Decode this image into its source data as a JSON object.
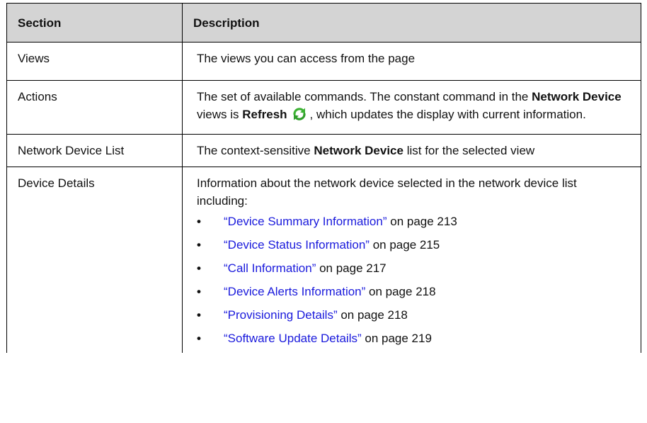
{
  "headers": {
    "section": "Section",
    "description": "Description"
  },
  "rows": {
    "views": {
      "section": "Views",
      "description": "The views you can access from the page"
    },
    "actions": {
      "section": "Actions",
      "text_1": "The set of available commands. The constant command in the ",
      "bold_1": "Network Device",
      "text_2": " views is ",
      "bold_2": "Refresh",
      "text_3": ", which updates the display with current information.",
      "icon": "refresh-icon"
    },
    "list": {
      "section": "Network Device List",
      "text_1": "The context-sensitive ",
      "bold_1": "Network Device",
      "text_2": " list for the selected view"
    },
    "details": {
      "section": "Device Details",
      "intro": "Information about the network device selected in the network device list including:",
      "bullet": "•",
      "items": [
        {
          "link": "“Device Summary Information”",
          "suffix": " on page 213"
        },
        {
          "link": "“Device Status Information”",
          "suffix": " on page 215"
        },
        {
          "link": "“Call Information”",
          "suffix": " on page 217"
        },
        {
          "link": "“Device Alerts Information”",
          "suffix": " on page 218"
        },
        {
          "link": "“Provisioning Details”",
          "suffix": " on page 218"
        },
        {
          "link": "“Software Update Details”",
          "suffix": " on page 219"
        }
      ]
    }
  },
  "colors": {
    "header_bg": "#d4d4d4",
    "link": "#1a1adc",
    "icon": "#3cb233"
  }
}
